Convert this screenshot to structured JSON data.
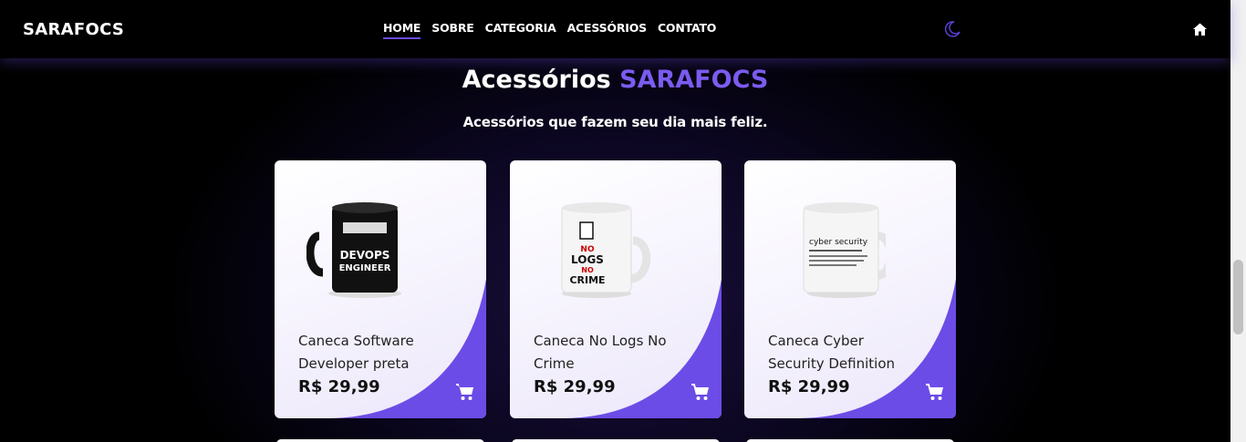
{
  "brand": "SARAFOCS",
  "nav": {
    "items": [
      {
        "label": "HOME",
        "active": true
      },
      {
        "label": "SOBRE",
        "active": false
      },
      {
        "label": "CATEGORIA",
        "active": false
      },
      {
        "label": "ACESSÓRIOS",
        "active": false
      },
      {
        "label": "CONTATO",
        "active": false
      }
    ]
  },
  "icons": {
    "theme": "moon-icon",
    "home": "home-icon",
    "cart": "cart-icon"
  },
  "colors": {
    "accent": "#6c4ce6",
    "accent_light": "#7b5cf0",
    "background": "#000000"
  },
  "section": {
    "title_prefix": "Acessórios",
    "title_accent": "SARAFOCS",
    "subtitle": "Acessórios que fazem seu dia mais feliz."
  },
  "products": [
    {
      "name": "Caneca Software Developer preta",
      "price": "R$ 29,99",
      "mug_text": [
        "DEVOPS",
        "ENGINEER"
      ],
      "mug_color": "#111111"
    },
    {
      "name": "Caneca No Logs No Crime",
      "price": "R$ 29,99",
      "mug_text": [
        "NO",
        "LOGS",
        "NO",
        "CRIME"
      ],
      "mug_color": "#f2f2f2"
    },
    {
      "name": "Caneca Cyber Security Definition",
      "price": "R$ 29,99",
      "mug_text": [
        "cyber security"
      ],
      "mug_color": "#f2f2f2"
    }
  ]
}
